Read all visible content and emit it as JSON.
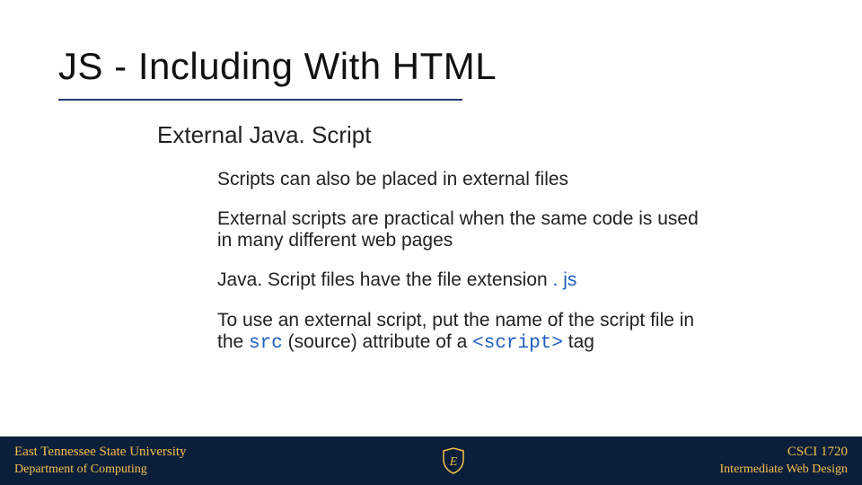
{
  "title": "JS - Including With HTML",
  "subtitle": "External Java. Script",
  "body": {
    "p1": "Scripts can also be placed in external files",
    "p2": "External scripts are practical when the same code is used in many different web pages",
    "p3_pre": "Java. Script files have the file extension ",
    "p3_ext": ". js",
    "p4_a": "To use an external script, put the name of the script file in the ",
    "p4_src": "src",
    "p4_b": " (source) attribute of a ",
    "p4_tag": "<script>",
    "p4_c": "  tag"
  },
  "footer": {
    "left_line1": "East Tennessee State University",
    "left_line2": "Department of Computing",
    "logo_letter": "E",
    "right_line1": "CSCI 1720",
    "right_line2": "Intermediate Web Design"
  },
  "colors": {
    "footer_bg": "#0b1e3a",
    "footer_text": "#f3c14b",
    "accent_blue": "#1f5fbf",
    "rule": "#1f3a6e"
  }
}
